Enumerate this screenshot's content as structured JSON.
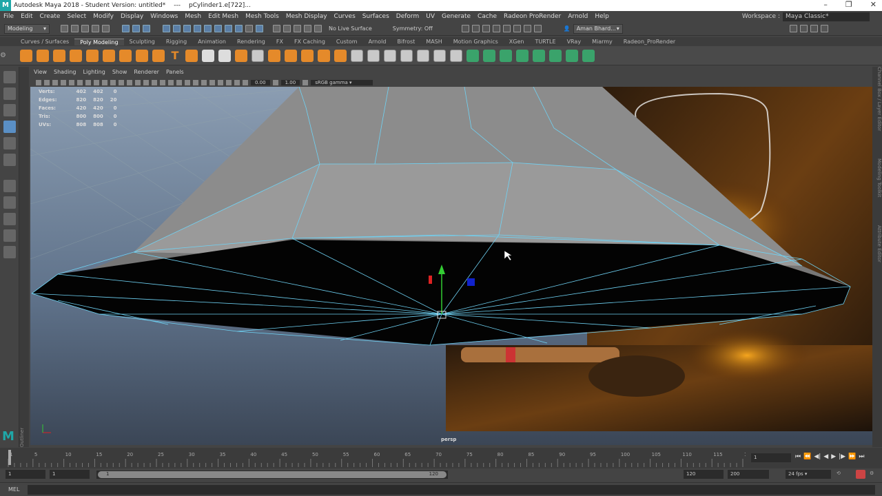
{
  "titlebar": {
    "app": "Autodesk Maya 2018 - Student Version: untitled*",
    "sep": "---",
    "object": "pCylinder1.e[722]..."
  },
  "menubar": {
    "items": [
      "File",
      "Edit",
      "Create",
      "Select",
      "Modify",
      "Display",
      "Windows",
      "Mesh",
      "Edit Mesh",
      "Mesh Tools",
      "Mesh Display",
      "Curves",
      "Surfaces",
      "Deform",
      "UV",
      "Generate",
      "Cache",
      "Radeon ProRender",
      "Arnold",
      "Help"
    ],
    "workspace_label": "Workspace :",
    "workspace_value": "Maya Classic*"
  },
  "statusline": {
    "mode": "Modeling",
    "live_surface": "No Live Surface",
    "symmetry": "Symmetry: Off",
    "user": "Aman Bhard..."
  },
  "shelf": {
    "tabs": [
      "Curves / Surfaces",
      "Poly Modeling",
      "Sculpting",
      "Rigging",
      "Animation",
      "Rendering",
      "FX",
      "FX Caching",
      "Custom",
      "Arnold",
      "Bifrost",
      "MASH",
      "Motion Graphics",
      "XGen",
      "TURTLE",
      "VRay",
      "Miarmy",
      "Radeon_ProRender"
    ],
    "active_tab": 1
  },
  "viewport": {
    "menu": [
      "View",
      "Shading",
      "Lighting",
      "Show",
      "Renderer",
      "Panels"
    ],
    "exposure": "0.00",
    "gamma": "1.00",
    "colorspace": "sRGB gamma",
    "camera": "persp",
    "hud": [
      {
        "label": "Verts:",
        "a": "402",
        "b": "402",
        "c": "0"
      },
      {
        "label": "Edges:",
        "a": "820",
        "b": "820",
        "c": "20"
      },
      {
        "label": "Faces:",
        "a": "420",
        "b": "420",
        "c": "0"
      },
      {
        "label": "Tris:",
        "a": "800",
        "b": "800",
        "c": "0"
      },
      {
        "label": "UVs:",
        "a": "808",
        "b": "808",
        "c": "0"
      }
    ]
  },
  "right_strip": [
    "Channel Box / Layer Editor",
    "Modeling Toolkit",
    "Attribute Editor"
  ],
  "outliner_label": "Outliner",
  "timeslider": {
    "ticks": [
      "1",
      "5",
      "10",
      "15",
      "20",
      "25",
      "30",
      "35",
      "40",
      "45",
      "50",
      "55",
      "60",
      "65",
      "70",
      "75",
      "80",
      "85",
      "90",
      "95",
      "100",
      "105",
      "110",
      "115",
      "120"
    ],
    "current": "1"
  },
  "range": {
    "start": "1",
    "start2": "1",
    "range_start": "1",
    "range_end": "120",
    "end": "120",
    "end2": "200",
    "fps": "24 fps"
  },
  "cmdline": {
    "lang": "MEL"
  },
  "colors": {
    "accent": "#5a8fc5",
    "wire": "#6fd3f5",
    "orange": "#e58a2a"
  }
}
